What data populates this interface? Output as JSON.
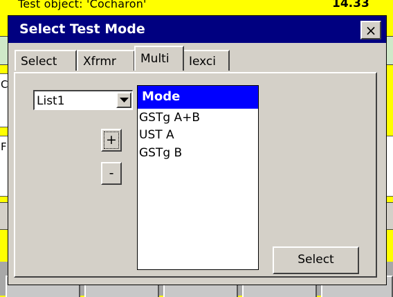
{
  "background": {
    "header_text": "Test object: 'Cocharon'",
    "header_time": "14.33",
    "left_letters": [
      "C",
      "F"
    ]
  },
  "dialog": {
    "title": "Select Test Mode",
    "close_glyph": "×"
  },
  "tabs": [
    {
      "label": "Select",
      "active": false
    },
    {
      "label": "Xfrmr",
      "active": false
    },
    {
      "label": "Multi",
      "active": true
    },
    {
      "label": "Iexci",
      "active": false
    }
  ],
  "dropdown": {
    "value": "List1",
    "icon": "chevron-down-icon"
  },
  "buttons": {
    "add": "+",
    "remove": "-",
    "select": "Select"
  },
  "mode_list": {
    "header": "Mode",
    "items": [
      "GSTg A+B",
      "UST A",
      "GSTg B"
    ]
  },
  "colors": {
    "background": "#ffff00",
    "titlebar": "#000080",
    "list_header": "#0000ff",
    "face": "#d4d0c8"
  }
}
